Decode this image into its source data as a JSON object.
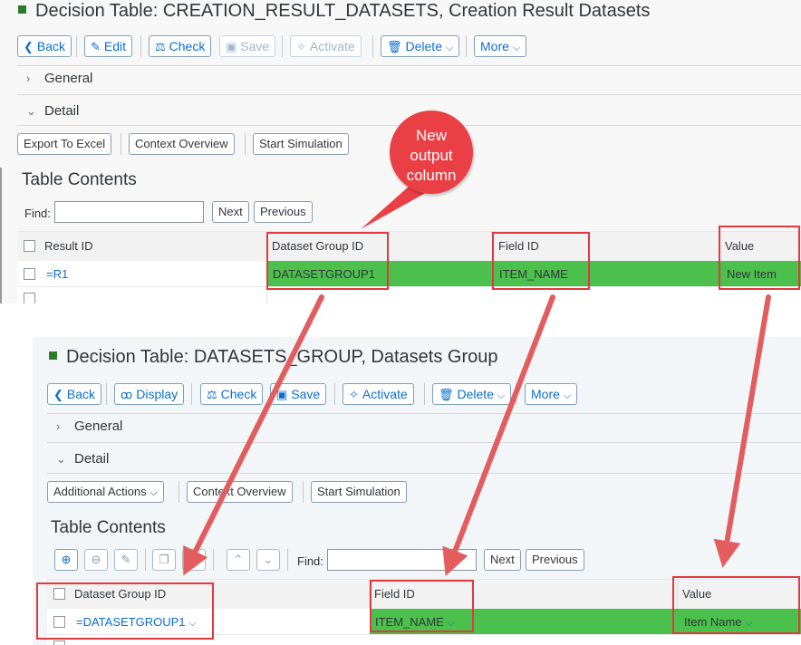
{
  "top_screen": {
    "title": "Decision Table: CREATION_RESULT_DATASETS, Creation Result Datasets",
    "toolbar": {
      "back": "Back",
      "edit": "Edit",
      "check": "Check",
      "save": "Save",
      "activate": "Activate",
      "delete": "Delete",
      "more": "More"
    },
    "sections": {
      "general": "General",
      "detail": "Detail"
    },
    "actions": {
      "export": "Export To Excel",
      "context": "Context Overview",
      "simulation": "Start Simulation"
    },
    "table_title": "Table Contents",
    "find": {
      "label": "Find:",
      "value": "",
      "next": "Next",
      "previous": "Previous"
    },
    "columns": [
      "Result ID",
      "Dataset Group ID",
      "Field ID",
      "Value"
    ],
    "rows": [
      {
        "result_id": "=R1",
        "dataset_group_id": "DATASETGROUP1",
        "field_id": "ITEM_NAME",
        "value": "New Item"
      }
    ]
  },
  "callout": {
    "line1": "New",
    "line2": "output",
    "line3": "column"
  },
  "bottom_screen": {
    "title": "Decision Table: DATASETS_GROUP, Datasets Group",
    "toolbar": {
      "back": "Back",
      "display": "Display",
      "check": "Check",
      "save": "Save",
      "activate": "Activate",
      "delete": "Delete",
      "more": "More"
    },
    "sections": {
      "general": "General",
      "detail": "Detail"
    },
    "actions": {
      "additional": "Additional Actions",
      "context": "Context Overview",
      "simulation": "Start Simulation"
    },
    "table_title": "Table Contents",
    "find": {
      "label": "Find:",
      "value": "",
      "next": "Next",
      "previous": "Previous"
    },
    "columns": [
      "Dataset Group ID",
      "Field ID",
      "Value"
    ],
    "rows": [
      {
        "dataset_group_id": "=DATASETGROUP1",
        "field_id": "ITEM_NAME",
        "value": "Item Name"
      }
    ]
  },
  "colors": {
    "accent": "#0a6ed1",
    "highlight_green": "#4cc04c",
    "annotation_red": "#e0393e",
    "status_square": "#2b7d2b"
  }
}
